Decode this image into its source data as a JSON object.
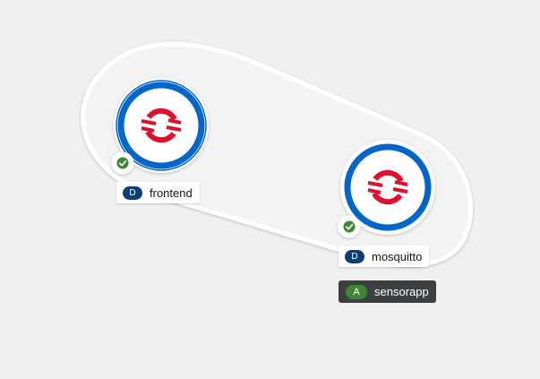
{
  "topology": {
    "application_group": {
      "badge": "A",
      "name": "sensorapp",
      "badge_color": "#3e8635"
    },
    "nodes": [
      {
        "id": "frontend",
        "badge": "D",
        "name": "frontend",
        "kind": "Deployment",
        "status": "ready",
        "status_icon": "check-circle-icon",
        "icon": "openshift-logo-icon"
      },
      {
        "id": "mosquitto",
        "badge": "D",
        "name": "mosquitto",
        "kind": "Deployment",
        "status": "ready",
        "status_icon": "check-circle-icon",
        "icon": "openshift-logo-icon"
      }
    ],
    "colors": {
      "background": "#f0f0f0",
      "group_fill": "#f3f3f3",
      "group_stroke": "#ffffff",
      "pod_ring": "#0066cc",
      "logo_red": "#e00f2b",
      "status_green": "#3e8635",
      "deployment_badge": "#0f3e75",
      "app_label_bg": "#3c3f42"
    }
  }
}
